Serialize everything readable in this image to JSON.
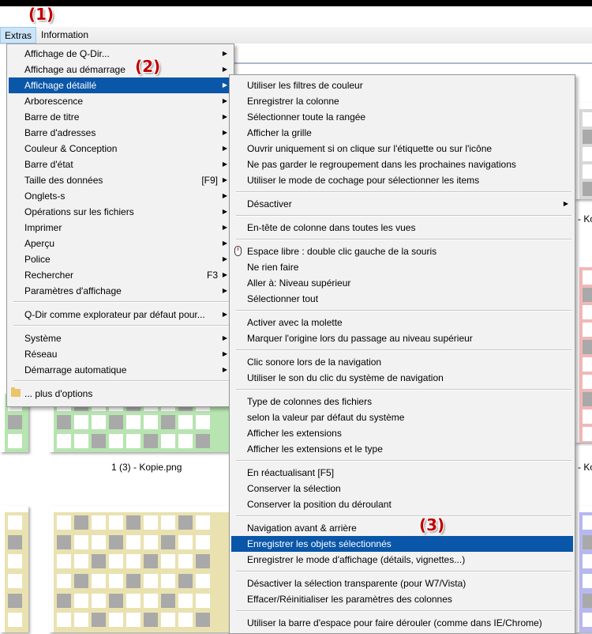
{
  "annotations": [
    "(1)",
    "(2)",
    "(3)"
  ],
  "menubar": {
    "items": [
      "Extras",
      "Information"
    ]
  },
  "extras_menu": {
    "items": [
      {
        "label": "Affichage de Q-Dir...",
        "arrow": true
      },
      {
        "label": "Affichage au démarrage",
        "arrow": true
      },
      {
        "label": "Affichage détaillé",
        "arrow": true,
        "highlighted": true
      },
      {
        "label": "Arborescence",
        "arrow": true
      },
      {
        "label": "Barre de titre",
        "arrow": true
      },
      {
        "label": "Barre d'adresses",
        "arrow": true
      },
      {
        "label": "Couleur & Conception",
        "arrow": true
      },
      {
        "label": "Barre d'état",
        "arrow": true
      },
      {
        "label": "Taille des données",
        "shortcut": "[F9]",
        "arrow": true
      },
      {
        "label": "Onglets-s",
        "arrow": true
      },
      {
        "label": "Opérations sur les fichiers",
        "arrow": true
      },
      {
        "label": "Imprimer",
        "arrow": true
      },
      {
        "label": "Aperçu",
        "arrow": true
      },
      {
        "label": "Police",
        "arrow": true
      },
      {
        "label": "Rechercher",
        "shortcut": "F3",
        "arrow": true
      },
      {
        "label": "Paramètres d'affichage",
        "arrow": true
      },
      {
        "label": "Q-Dir comme explorateur par défaut pour...",
        "arrow": true
      },
      {
        "label": "Système",
        "arrow": true
      },
      {
        "label": "Réseau",
        "arrow": true
      },
      {
        "label": "Démarrage automatique",
        "arrow": true
      },
      {
        "label": "... plus d'options",
        "arrow": false,
        "icon": "folder-icon"
      }
    ]
  },
  "submenu": {
    "items": [
      {
        "label": "Utiliser les filtres de couleur"
      },
      {
        "label": "Enregistrer la colonne"
      },
      {
        "label": "Sélectionner toute la rangée"
      },
      {
        "label": "Afficher la grille"
      },
      {
        "label": "Ouvrir uniquement si on clique sur l'étiquette ou sur l'icône"
      },
      {
        "label": "Ne pas garder le regroupement dans les prochaines navigations"
      },
      {
        "label": "Utiliser le mode de cochage pour sélectionner les items"
      },
      {
        "label": "Désactiver",
        "arrow": true
      },
      {
        "label": "En-tête de colonne dans toutes les vues"
      },
      {
        "label": "Espace libre : double clic gauche de la souris",
        "icon": "mouse-icon"
      },
      {
        "label": "Ne rien faire"
      },
      {
        "label": "Aller à: Niveau supérieur"
      },
      {
        "label": "Sélectionner tout"
      },
      {
        "label": "Activer avec la molette"
      },
      {
        "label": "Marquer l'origine lors du passage au niveau supérieur"
      },
      {
        "label": "Clic sonore lors de la navigation"
      },
      {
        "label": "Utiliser le son du clic du système de navigation"
      },
      {
        "label": "Type de colonnes des fichiers"
      },
      {
        "label": "selon la valeur par défaut du système"
      },
      {
        "label": "Afficher les extensions"
      },
      {
        "label": "Afficher les extensions et le type"
      },
      {
        "label": "En réactualisant [F5]"
      },
      {
        "label": "Conserver la sélection"
      },
      {
        "label": "Conserver la position du déroulant"
      },
      {
        "label": "Navigation avant & arrière"
      },
      {
        "label": "Enregistrer les objets sélectionnés",
        "highlighted": true
      },
      {
        "label": "Enregistrer le mode d'affichage (détails, vignettes...)"
      },
      {
        "label": "Désactiver la sélection transparente (pour W7/Vista)"
      },
      {
        "label": "Effacer/Réinitialiser les paramètres des colonnes"
      },
      {
        "label": "Utiliser la barre d'espace pour faire dérouler (comme dans IE/Chrome)"
      }
    ]
  },
  "background": {
    "file_label": "1 (3) - Kopie.png",
    "right_labels": [
      "- Ko",
      "- Ko"
    ]
  },
  "colors": {
    "highlight": "#0a56a8",
    "annotation": "#c00000",
    "thumb_green": "#b7e4b0",
    "thumb_yellow": "#e9e2b0",
    "thumb_red": "#f0b8b8",
    "thumb_blue": "#b8b8f0",
    "cell_gray": "#a9a9a9"
  }
}
